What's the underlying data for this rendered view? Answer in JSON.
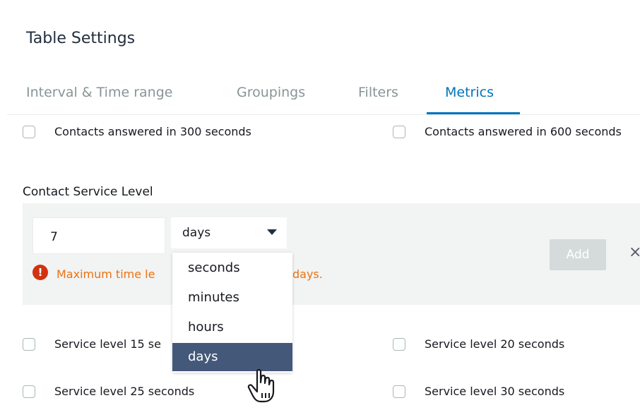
{
  "dialog": {
    "title": "Table Settings"
  },
  "tabs": [
    {
      "label": "Interval & Time range"
    },
    {
      "label": "Groupings"
    },
    {
      "label": "Filters"
    },
    {
      "label": "Metrics",
      "active": true
    }
  ],
  "metrics_top": [
    {
      "label": "Contacts answered in 300 seconds",
      "checked": false
    },
    {
      "label": "Contacts answered in 600 seconds",
      "checked": false
    }
  ],
  "service_level": {
    "label": "Contact Service Level",
    "value": "7",
    "unit": "days",
    "error_text_start": "Maximum time le",
    "error_text_end": "days.",
    "add_label": "Add",
    "remove_glyph": "×"
  },
  "unit_dropdown": {
    "options": [
      "seconds",
      "minutes",
      "hours",
      "days"
    ],
    "selected": "days"
  },
  "metrics_bottom": [
    {
      "label": "Service level 15 se",
      "checked": false
    },
    {
      "label": "Service level 20 seconds",
      "checked": false
    },
    {
      "label": "Service level 25 seconds",
      "checked": false
    },
    {
      "label": "Service level 30 seconds",
      "checked": false
    }
  ],
  "colors": {
    "accent": "#0073bb",
    "error": "#ec7211",
    "error_icon": "#d13212",
    "dropdown_selected": "#44587a",
    "disabled_button": "#d5dbdb"
  },
  "icons": {
    "error": "exclamation-circle-icon",
    "caret": "caret-down-icon",
    "cursor": "hand-pointer-icon"
  }
}
